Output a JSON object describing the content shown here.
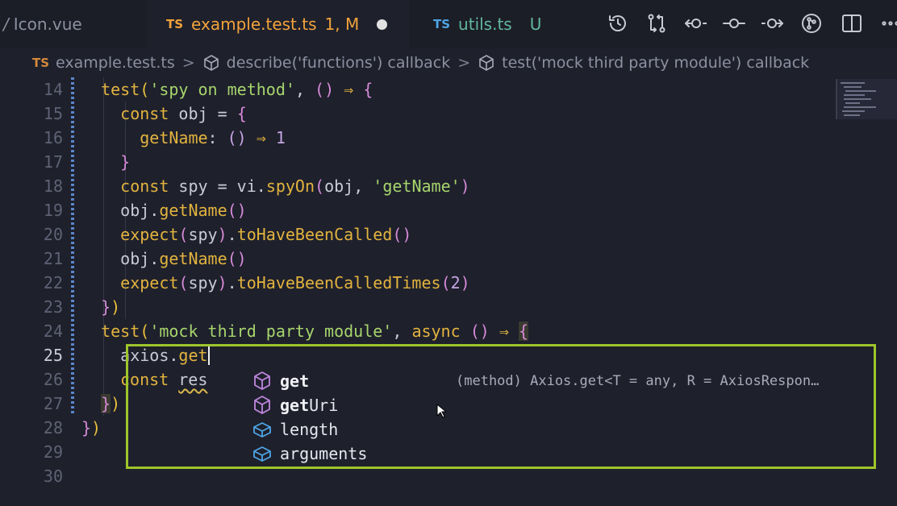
{
  "tabs": [
    {
      "prefix": "/",
      "name": "Icon.vue",
      "lang": "",
      "status": ""
    },
    {
      "prefix": "",
      "name": "example.test.ts",
      "lang": "TS",
      "status": "1, M",
      "active": true
    },
    {
      "prefix": "",
      "name": "utils.ts",
      "lang": "TS",
      "status": "U"
    }
  ],
  "toolbar_icons": [
    "history-icon",
    "compare-changes-icon",
    "previous-change-icon",
    "change-icon",
    "next-change-icon",
    "git-graph-icon",
    "split-editor-icon",
    "more-actions-icon"
  ],
  "breadcrumb": {
    "lang": "TS",
    "file": "example.test.ts",
    "sep": ">",
    "item1": "describe('functions') callback",
    "item2": "test('mock third party module') callback"
  },
  "editor": {
    "line_numbers": [
      "14",
      "15",
      "16",
      "17",
      "18",
      "19",
      "20",
      "21",
      "22",
      "23",
      "24",
      "25",
      "26",
      "27",
      "28",
      "29",
      "30"
    ],
    "line25_text": "axios.get",
    "line26_text": "const res",
    "colors": {
      "background": "#1e202c",
      "string": "#a7d56c",
      "keyword": "#e2b33e",
      "highlight_box": "#9fc52a"
    }
  },
  "suggestions": [
    {
      "match": "get",
      "rest": "",
      "kind": "method",
      "icon": "method-cube-icon",
      "detail": "(method) Axios.get<T = any, R = AxiosRespon…"
    },
    {
      "match": "get",
      "rest": "Uri",
      "kind": "method",
      "icon": "method-cube-icon",
      "detail": ""
    },
    {
      "match": "",
      "rest": "length",
      "kind": "property",
      "icon": "property-box-icon",
      "detail": ""
    },
    {
      "match": "",
      "rest": "arguments",
      "kind": "property",
      "icon": "property-box-icon",
      "detail": ""
    }
  ]
}
